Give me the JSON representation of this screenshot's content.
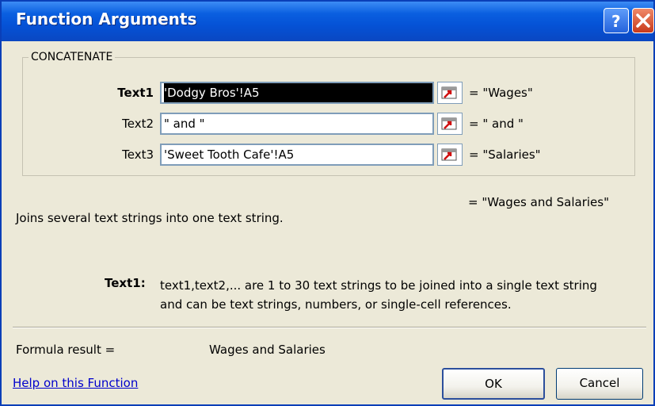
{
  "window": {
    "title": "Function Arguments"
  },
  "function_name": "CONCATENATE",
  "arguments": [
    {
      "label": "Text1",
      "value": "'Dodgy Bros'!A5",
      "result": "= \"Wages\""
    },
    {
      "label": "Text2",
      "value": "\" and \"",
      "result": "= \" and \""
    },
    {
      "label": "Text3",
      "value": "'Sweet Tooth Cafe'!A5",
      "result": "= \"Salaries\""
    }
  ],
  "overall_result": "= \"Wages and Salaries\"",
  "description": "Joins several text strings into one text string.",
  "argument_help": {
    "label": "Text1:",
    "text": "text1,text2,... are 1 to 30 text strings to be joined into a single text string and can be text strings, numbers, or single-cell references."
  },
  "formula_result": {
    "label": "Formula result =",
    "value": "Wages and Salaries"
  },
  "help_link": "Help on this Function",
  "buttons": {
    "ok": "OK",
    "cancel": "Cancel"
  },
  "icons": {
    "help": "help-icon",
    "close": "close-icon",
    "collapse": "collapse-dialog-icon"
  },
  "colors": {
    "titlebar": "#0552d6",
    "link": "#0000cc",
    "dialog_bg": "#ece9d8"
  }
}
